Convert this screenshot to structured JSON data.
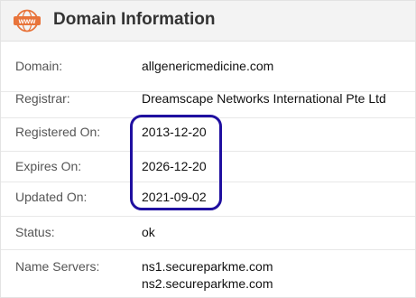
{
  "header": {
    "icon_text": "www",
    "title": "Domain Information"
  },
  "rows": [
    {
      "label": "Domain:",
      "value": "allgenericmedicine.com"
    },
    {
      "label": "Registrar:",
      "value": "Dreamscape Networks International Pte Ltd"
    },
    {
      "label": "Registered On:",
      "value": "2013-12-20"
    },
    {
      "label": "Expires On:",
      "value": "2026-12-20"
    },
    {
      "label": "Updated On:",
      "value": "2021-09-02"
    },
    {
      "label": "Status:",
      "value": "ok"
    },
    {
      "label": "Name Servers:",
      "values": [
        "ns1.secureparkme.com",
        "ns2.secureparkme.com"
      ]
    }
  ],
  "colors": {
    "icon_accent": "#e8743b",
    "highlight_border": "#1f0fa0",
    "header_bg": "#f3f3f3"
  }
}
